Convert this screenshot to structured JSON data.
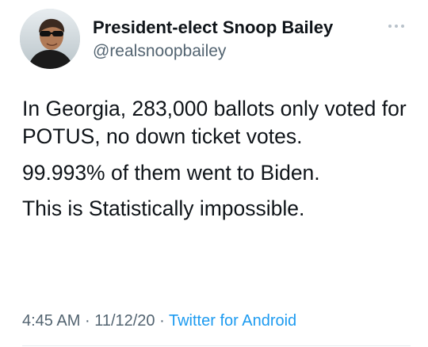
{
  "tweet": {
    "display_name": "President-elect Snoop Bailey",
    "handle": "@realsnoopbailey",
    "paragraphs": [
      "In Georgia, 283,000 ballots only voted for POTUS, no down ticket votes.",
      "99.993% of them went to Biden.",
      "This is Statistically impossible."
    ],
    "time": "4:45 AM",
    "date": "11/12/20",
    "separator": "·",
    "source": "Twitter for Android",
    "avatar_icon": "profile-photo",
    "more_icon": "more-horizontal-icon"
  },
  "colors": {
    "text": "#0f1419",
    "secondary": "#536471",
    "link": "#1d9bf0",
    "divider": "#e6ecf0"
  }
}
